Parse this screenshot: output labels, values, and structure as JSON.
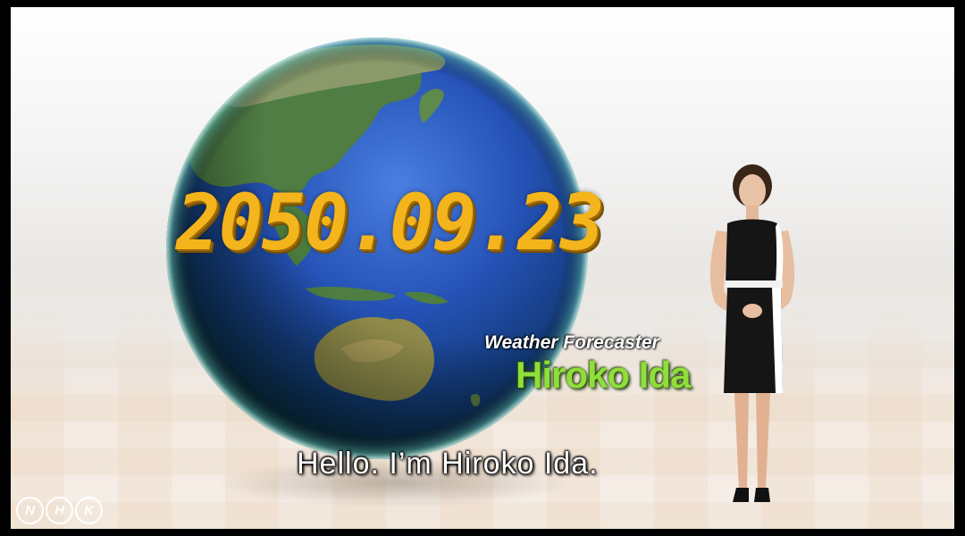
{
  "overlay": {
    "date": "2050.09.23",
    "caption_title": "Weather Forecaster",
    "caption_name": "Hiroko Ida",
    "subtitle": "Hello. I’m Hiroko Ida."
  },
  "logo": {
    "letters": [
      "N",
      "H",
      "K"
    ]
  },
  "colors": {
    "date": "#f4b41c",
    "name": "#8fde3a",
    "ocean": "#1f4fae"
  }
}
